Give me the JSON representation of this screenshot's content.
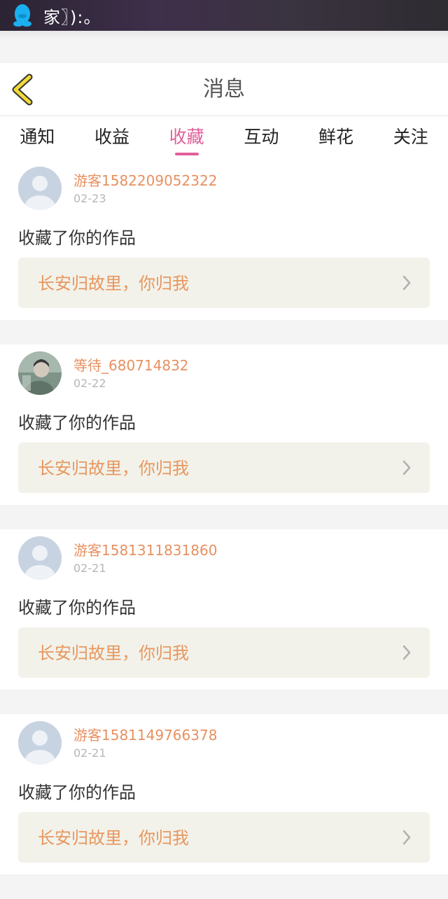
{
  "status_bar": {
    "text": "家〗):。"
  },
  "header": {
    "title": "消息"
  },
  "tabs": [
    {
      "label": "通知"
    },
    {
      "label": "收益"
    },
    {
      "label": "收藏"
    },
    {
      "label": "互动"
    },
    {
      "label": "鲜花"
    },
    {
      "label": "关注"
    }
  ],
  "active_tab": "收藏",
  "colors": {
    "accent": "#e0609a",
    "username": "#e89060",
    "work_title": "#e8965e",
    "work_box_bg": "#f2f2ea"
  },
  "feed": [
    {
      "username": "游客1582209052322",
      "date": "02-23",
      "action": "收藏了你的作品",
      "work_title": "长安归故里，你归我",
      "avatar": "default-avatar"
    },
    {
      "username": "等待_680714832",
      "date": "02-22",
      "action": "收藏了你的作品",
      "work_title": "长安归故里，你归我",
      "avatar": "photo-avatar"
    },
    {
      "username": "游客1581311831860",
      "date": "02-21",
      "action": "收藏了你的作品",
      "work_title": "长安归故里，你归我",
      "avatar": "default-avatar"
    },
    {
      "username": "游客1581149766378",
      "date": "02-21",
      "action": "收藏了你的作品",
      "work_title": "长安归故里，你归我",
      "avatar": "default-avatar"
    }
  ]
}
